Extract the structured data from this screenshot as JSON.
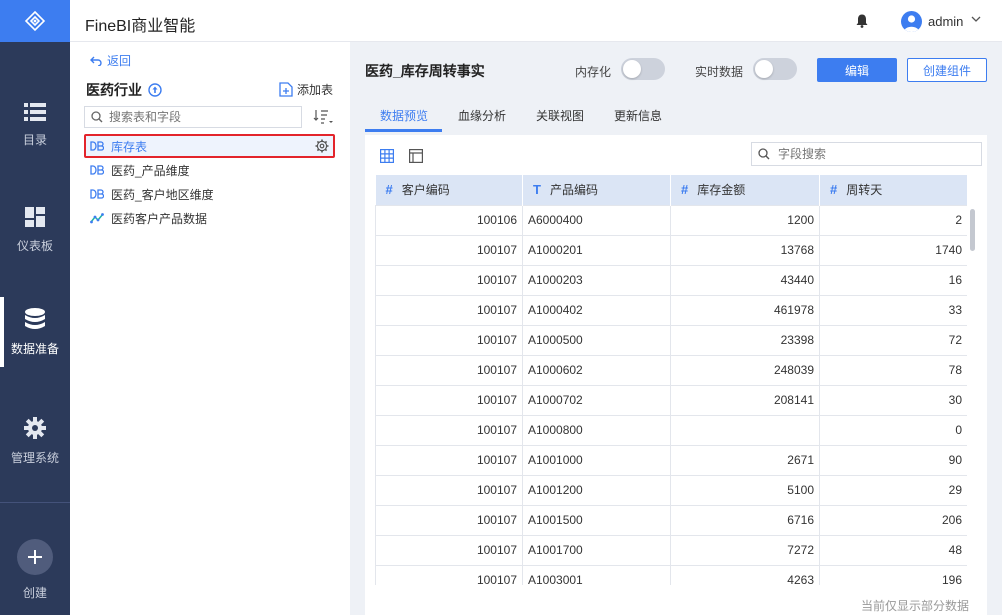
{
  "app": {
    "title": "FineBI商业智能"
  },
  "user": {
    "name": "admin"
  },
  "nav": {
    "items": [
      {
        "label": "目录",
        "icon": "list-icon"
      },
      {
        "label": "仪表板",
        "icon": "dashboard-icon"
      },
      {
        "label": "数据准备",
        "icon": "database-icon",
        "active": true
      },
      {
        "label": "管理系统",
        "icon": "gear-icon"
      }
    ],
    "create_label": "创建"
  },
  "left": {
    "back_label": "返回",
    "package_title": "医药行业",
    "add_table_label": "添加表",
    "search_placeholder": "搜索表和字段",
    "tables": [
      {
        "label": "库存表",
        "icon": "db-table-icon",
        "selected": true
      },
      {
        "label": "医药_产品维度",
        "icon": "db-table-icon"
      },
      {
        "label": "医药_客户地区维度",
        "icon": "db-table-icon"
      },
      {
        "label": "医药客户产品数据",
        "icon": "analysis-table-icon"
      }
    ]
  },
  "main": {
    "title": "医药_库存周转事实",
    "toggles": {
      "memory_label": "内存化",
      "realtime_label": "实时数据"
    },
    "edit_label": "编辑",
    "create_component_label": "创建组件",
    "tabs": [
      "数据预览",
      "血缘分析",
      "关联视图",
      "更新信息"
    ],
    "active_tab": 0,
    "field_search_placeholder": "字段搜索",
    "footer_note": "当前仅显示部分数据"
  },
  "table": {
    "columns": [
      {
        "type": "#",
        "label": "客户编码"
      },
      {
        "type": "T",
        "label": "产品编码"
      },
      {
        "type": "#",
        "label": "库存金额"
      },
      {
        "type": "#",
        "label": "周转天"
      }
    ],
    "rows": [
      [
        "100106",
        "A6000400",
        "1200",
        "2"
      ],
      [
        "100107",
        "A1000201",
        "13768",
        "1740"
      ],
      [
        "100107",
        "A1000203",
        "43440",
        "16"
      ],
      [
        "100107",
        "A1000402",
        "461978",
        "33"
      ],
      [
        "100107",
        "A1000500",
        "23398",
        "72"
      ],
      [
        "100107",
        "A1000602",
        "248039",
        "78"
      ],
      [
        "100107",
        "A1000702",
        "208141",
        "30"
      ],
      [
        "100107",
        "A1000800",
        "",
        "0"
      ],
      [
        "100107",
        "A1001000",
        "2671",
        "90"
      ],
      [
        "100107",
        "A1001200",
        "5100",
        "29"
      ],
      [
        "100107",
        "A1001500",
        "6716",
        "206"
      ],
      [
        "100107",
        "A1001700",
        "7272",
        "48"
      ],
      [
        "100107",
        "A1003001",
        "4263",
        "196"
      ]
    ]
  },
  "colors": {
    "accent": "#3d7df0",
    "nav_bg": "#2c3a5a",
    "highlight_border": "#e3242b"
  }
}
